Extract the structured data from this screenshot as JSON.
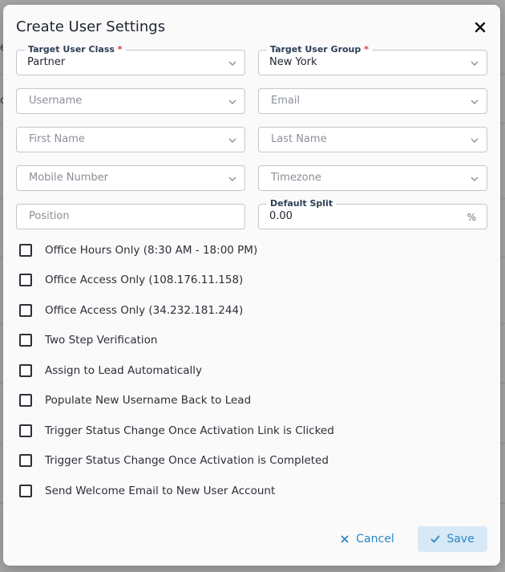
{
  "background": {
    "glyphs": [
      "e",
      "c"
    ]
  },
  "dialog": {
    "title": "Create User Settings",
    "close_icon": "close-icon"
  },
  "fields": {
    "target_user_class": {
      "label": "Target User Class",
      "required_mark": "*",
      "value": "Partner"
    },
    "target_user_group": {
      "label": "Target User Group",
      "required_mark": "*",
      "value": "New York"
    },
    "username": {
      "placeholder": "Username"
    },
    "email": {
      "placeholder": "Email"
    },
    "first_name": {
      "placeholder": "First Name"
    },
    "last_name": {
      "placeholder": "Last Name"
    },
    "mobile_number": {
      "placeholder": "Mobile Number"
    },
    "timezone": {
      "placeholder": "Timezone"
    },
    "position": {
      "placeholder": "Position"
    },
    "default_split": {
      "label": "Default Split",
      "value": "0.00",
      "suffix": "%"
    }
  },
  "options": [
    {
      "label": "Office Hours Only (8:30 AM - 18:00 PM)",
      "checked": false
    },
    {
      "label": "Office Access Only (108.176.11.158)",
      "checked": false
    },
    {
      "label": "Office Access Only (34.232.181.244)",
      "checked": false
    },
    {
      "label": "Two Step Verification",
      "checked": false
    },
    {
      "label": "Assign to Lead Automatically",
      "checked": false
    },
    {
      "label": "Populate New Username Back to Lead",
      "checked": false
    },
    {
      "label": "Trigger Status Change Once Activation Link is Clicked",
      "checked": false
    },
    {
      "label": "Trigger Status Change Once Activation is Completed",
      "checked": false
    },
    {
      "label": "Send Welcome Email to New User Account",
      "checked": false
    }
  ],
  "actions": {
    "cancel_label": "Cancel",
    "save_label": "Save"
  },
  "colors": {
    "accent": "#2b86c5",
    "save_bg": "#d7e9f7",
    "required": "#d63a3a"
  }
}
